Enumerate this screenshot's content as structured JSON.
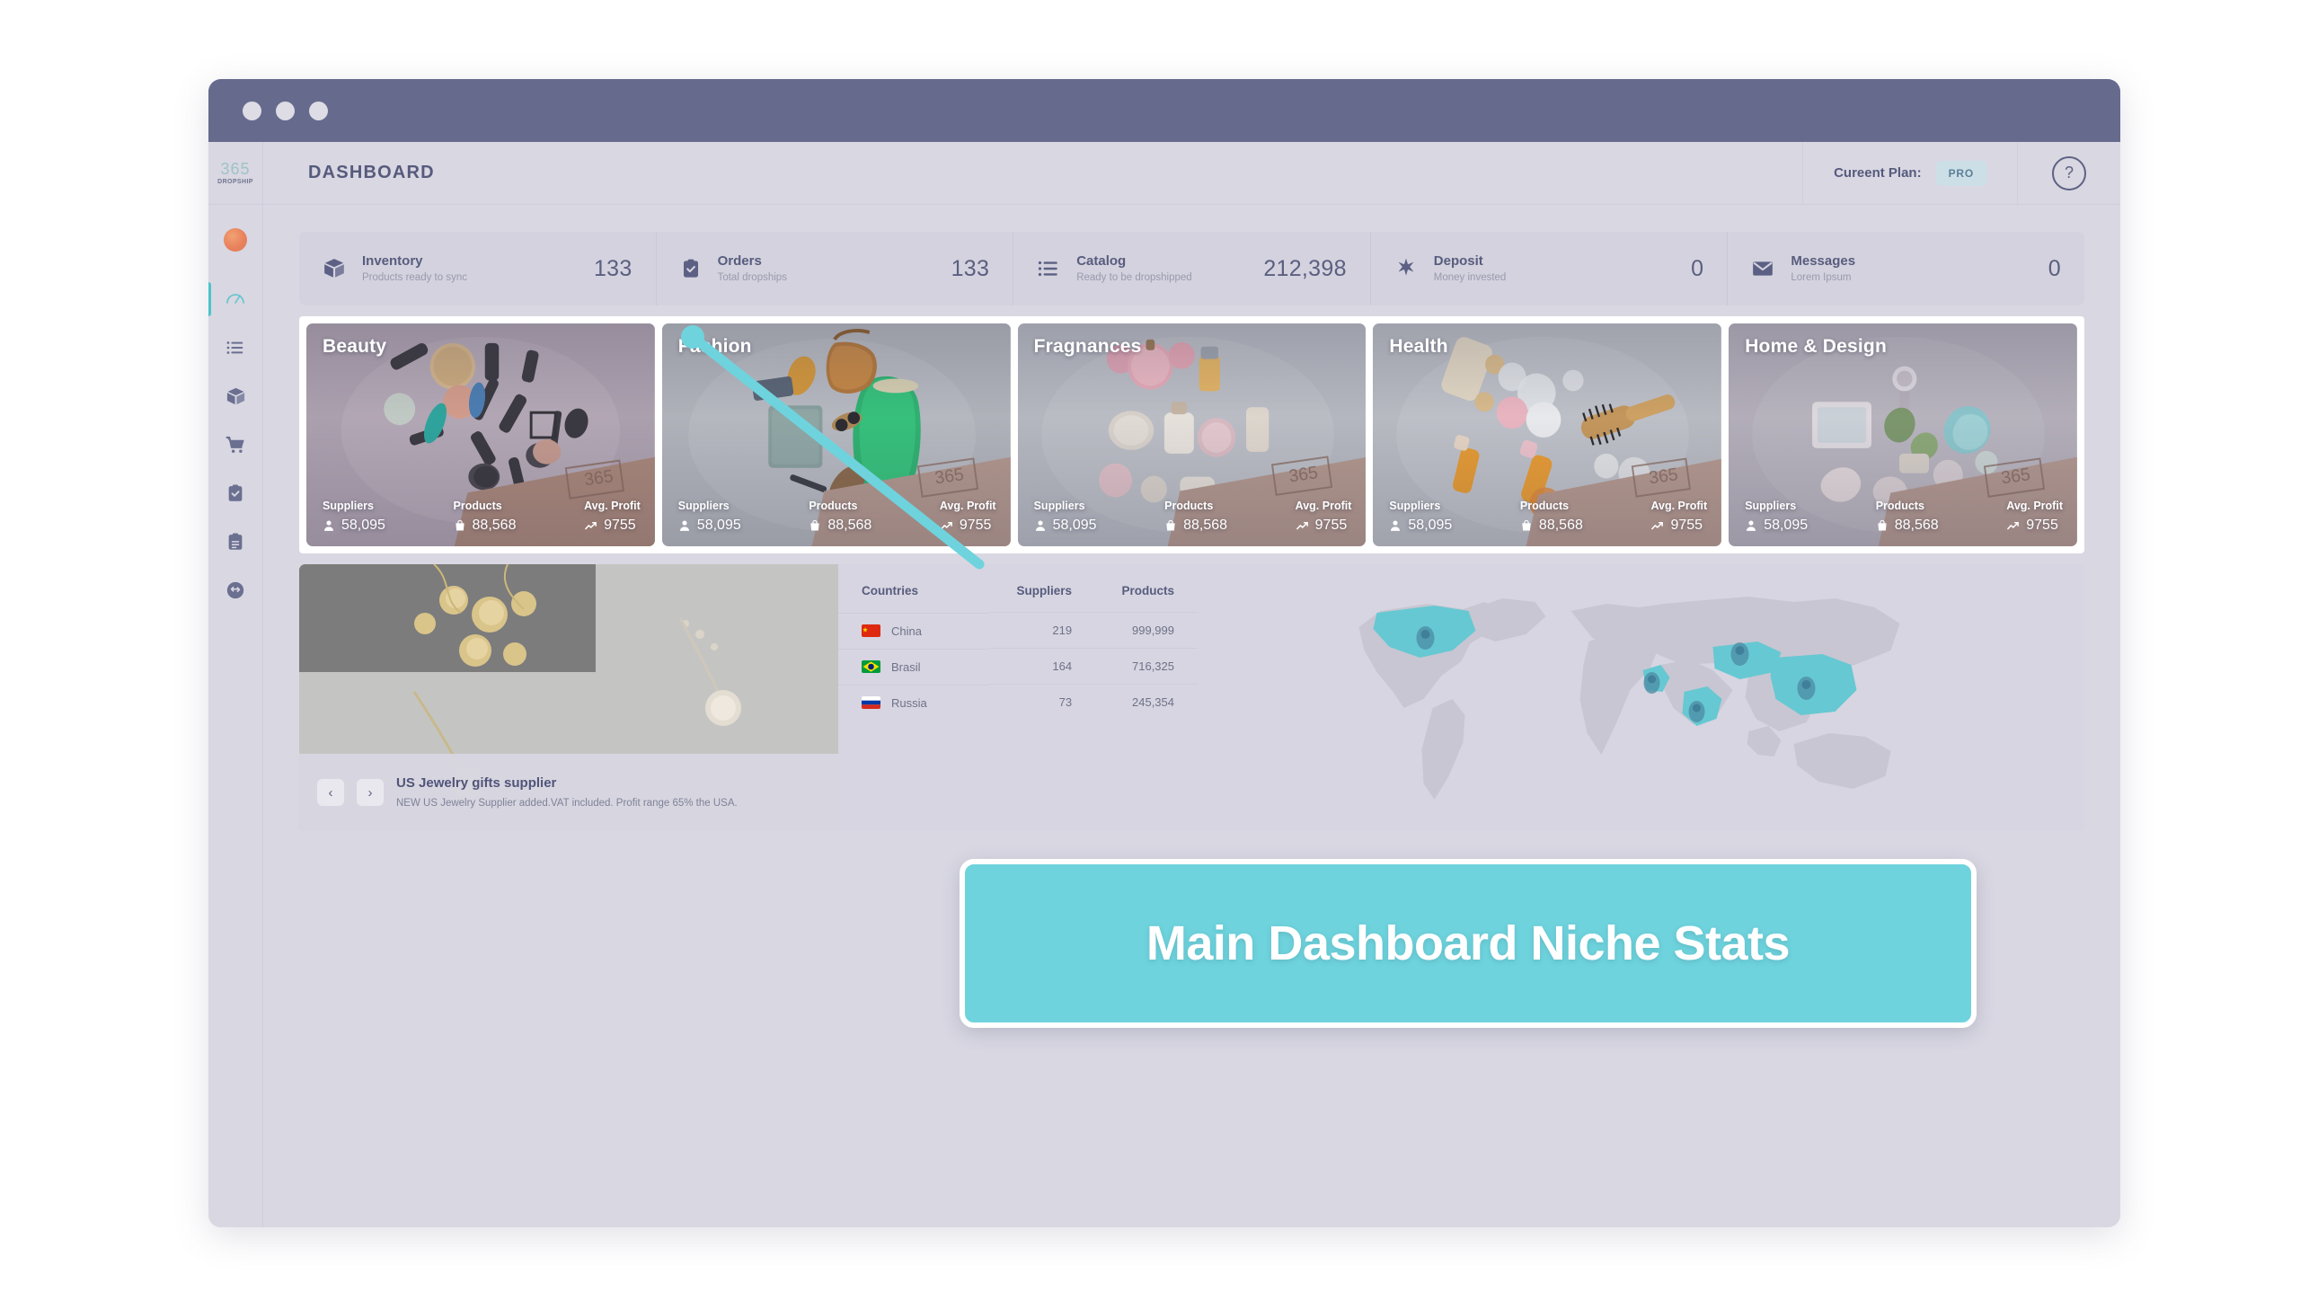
{
  "window": {
    "dots": [
      "dot-1",
      "dot-2",
      "dot-3"
    ]
  },
  "brand": {
    "name": "365",
    "subtitle": "DROPSHIP"
  },
  "header": {
    "title": "DASHBOARD",
    "plan_label": "Cureent Plan:",
    "plan_badge": "PRO",
    "help_icon": "question-mark-icon"
  },
  "sidebar": {
    "items": [
      {
        "icon": "avatar-icon",
        "label": "Profile"
      },
      {
        "icon": "speedometer-icon",
        "label": "Dashboard",
        "active": true
      },
      {
        "icon": "list-icon",
        "label": "Catalog"
      },
      {
        "icon": "box-icon",
        "label": "Inventory"
      },
      {
        "icon": "cart-icon",
        "label": "Orders"
      },
      {
        "icon": "clipboard-check-icon",
        "label": "Tasks"
      },
      {
        "icon": "clipboard-list-icon",
        "label": "Reports"
      },
      {
        "icon": "sync-icon",
        "label": "Sync"
      }
    ]
  },
  "stats": [
    {
      "icon": "box-icon",
      "title": "Inventory",
      "subtitle": "Products ready to sync",
      "value": "133"
    },
    {
      "icon": "clipboard-check-icon",
      "title": "Orders",
      "subtitle": "Total dropships",
      "value": "133"
    },
    {
      "icon": "list-icon",
      "title": "Catalog",
      "subtitle": "Ready to be dropshipped",
      "value": "212,398"
    },
    {
      "icon": "star-burst-icon",
      "title": "Deposit",
      "subtitle": "Money invested",
      "value": "0"
    },
    {
      "icon": "envelope-icon",
      "title": "Messages",
      "subtitle": "Lorem Ipsum",
      "value": "0"
    }
  ],
  "niches": {
    "stat_labels": {
      "suppliers": "Suppliers",
      "products": "Products",
      "avg_profit": "Avg. Profit"
    },
    "cards": [
      {
        "title": "Beauty",
        "suppliers": "58,095",
        "products": "88,568",
        "avg_profit": "9755"
      },
      {
        "title": "Fashion",
        "suppliers": "58,095",
        "products": "88,568",
        "avg_profit": "9755"
      },
      {
        "title": "Fragnances",
        "suppliers": "58,095",
        "products": "88,568",
        "avg_profit": "9755"
      },
      {
        "title": "Health",
        "suppliers": "58,095",
        "products": "88,568",
        "avg_profit": "9755"
      },
      {
        "title": "Home & Design",
        "suppliers": "58,095",
        "products": "88,568",
        "avg_profit": "9755"
      }
    ]
  },
  "promo": {
    "prev_icon": "chevron-left-icon",
    "next_icon": "chevron-right-icon",
    "title": "US Jewelry gifts supplier",
    "description": "NEW US Jewelry Supplier added.VAT included. Profit range 65% the USA."
  },
  "countries_table": {
    "headers": [
      "Countries",
      "Suppliers",
      "Products"
    ],
    "rows": [
      {
        "flag": "flag-china",
        "country": "China",
        "suppliers": "219",
        "products": "999,999"
      },
      {
        "flag": "flag-brazil",
        "country": "Brasil",
        "suppliers": "164",
        "products": "716,325"
      },
      {
        "flag": "flag-russia",
        "country": "Russia",
        "suppliers": "73",
        "products": "245,354"
      }
    ]
  },
  "callout": {
    "text": "Main Dashboard Niche Stats",
    "color": "#6ed3dd"
  },
  "colors": {
    "titlebar": "#666b8e",
    "app_background": "#d8d7e2",
    "panel": "#d3d2de",
    "accent": "#6ed3dd",
    "text_primary": "#565a7c",
    "text_muted": "#9a9aae",
    "plan_badge_bg": "#ccdfe6",
    "map_highlight": "#66c8d2"
  }
}
